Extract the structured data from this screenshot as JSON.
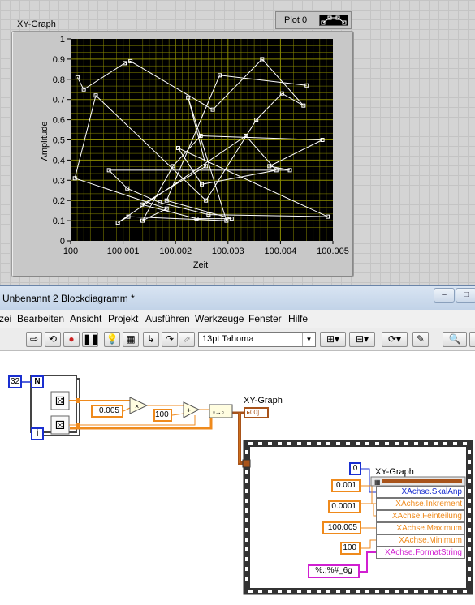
{
  "front_panel": {
    "graph_label": "XY-Graph",
    "plot_legend": "Plot 0",
    "colors": {
      "plot_bg": "#000000",
      "grid": "#8a8a00",
      "trace": "#ffffff"
    }
  },
  "chart_data": {
    "type": "scatter",
    "title": "XY-Graph",
    "xlabel": "Zeit",
    "ylabel": "Amplitude",
    "xlim": [
      100,
      100.005
    ],
    "ylim": [
      0,
      1
    ],
    "xticks": [
      "100",
      "100.001",
      "100.002",
      "100.003",
      "100.004",
      "100.005"
    ],
    "yticks": [
      "0",
      "0.1",
      "0.2",
      "0.3",
      "0.4",
      "0.5",
      "0.6",
      "0.7",
      "0.8",
      "0.9",
      "1"
    ],
    "grid": true,
    "connected": true,
    "series": [
      {
        "legend": "Plot 0",
        "x": [
          100.00013,
          100.00025,
          100.00103,
          100.00114,
          100.00271,
          100.00365,
          100.00444,
          100.00403,
          100.00354,
          100.00258,
          100.00048,
          100.00008,
          100.00183,
          100.00137,
          100.00195,
          100.00248,
          100.0048,
          100.00379,
          100.00418,
          100.00073,
          100.00108,
          100.0017,
          100.00263,
          100.0049,
          100.00205,
          100.0025,
          100.00392,
          100.00334,
          100.0009,
          100.0011,
          100.00297,
          100.00224,
          100.00258,
          100.00136,
          100.0024,
          100.00307,
          100.00183,
          100.00284,
          100.0045
        ],
        "y": [
          0.81,
          0.75,
          0.88,
          0.89,
          0.65,
          0.9,
          0.67,
          0.73,
          0.6,
          0.2,
          0.72,
          0.31,
          0.16,
          0.1,
          0.37,
          0.52,
          0.5,
          0.37,
          0.35,
          0.35,
          0.26,
          0.19,
          0.13,
          0.12,
          0.46,
          0.28,
          0.35,
          0.52,
          0.09,
          0.12,
          0.1,
          0.71,
          0.37,
          0.18,
          0.11,
          0.11,
          0.2,
          0.82,
          0.77
        ]
      }
    ]
  },
  "block_diagram": {
    "window_title": "Unbenannt 2 Blockdiagramm *",
    "window_buttons": [
      "–",
      "□"
    ],
    "menu": [
      "zei",
      "Bearbeiten",
      "Ansicht",
      "Projekt",
      "Ausführen",
      "Werkzeuge",
      "Fenster",
      "Hilfe"
    ],
    "font_select": "13pt Tahoma",
    "for_loop": {
      "count": "32",
      "N": "N",
      "i": "i"
    },
    "constants": {
      "multiplier": "0.005",
      "offset": "100",
      "enum_zero": "0"
    },
    "graph_terminal_label": "XY-Graph",
    "graph_terminal_glyph": "▸00]",
    "property_node": {
      "label": "XY-Graph",
      "properties": [
        {
          "name": "XAchse.SkalAnp",
          "value": "0",
          "color": "#1a2fd0"
        },
        {
          "name": "XAchse.Inkrement",
          "value": "0.001",
          "color": "#ef8a1c"
        },
        {
          "name": "XAchse.Feinteilung",
          "value": "0.0001",
          "color": "#ef8a1c"
        },
        {
          "name": "XAchse.Maximum",
          "value": "100.005",
          "color": "#ef8a1c"
        },
        {
          "name": "XAchse.Minimum",
          "value": "100",
          "color": "#ef8a1c"
        },
        {
          "name": "XAchse.FormatString",
          "value": "%.;%#_6g",
          "color": "#d11fd1"
        }
      ]
    }
  }
}
